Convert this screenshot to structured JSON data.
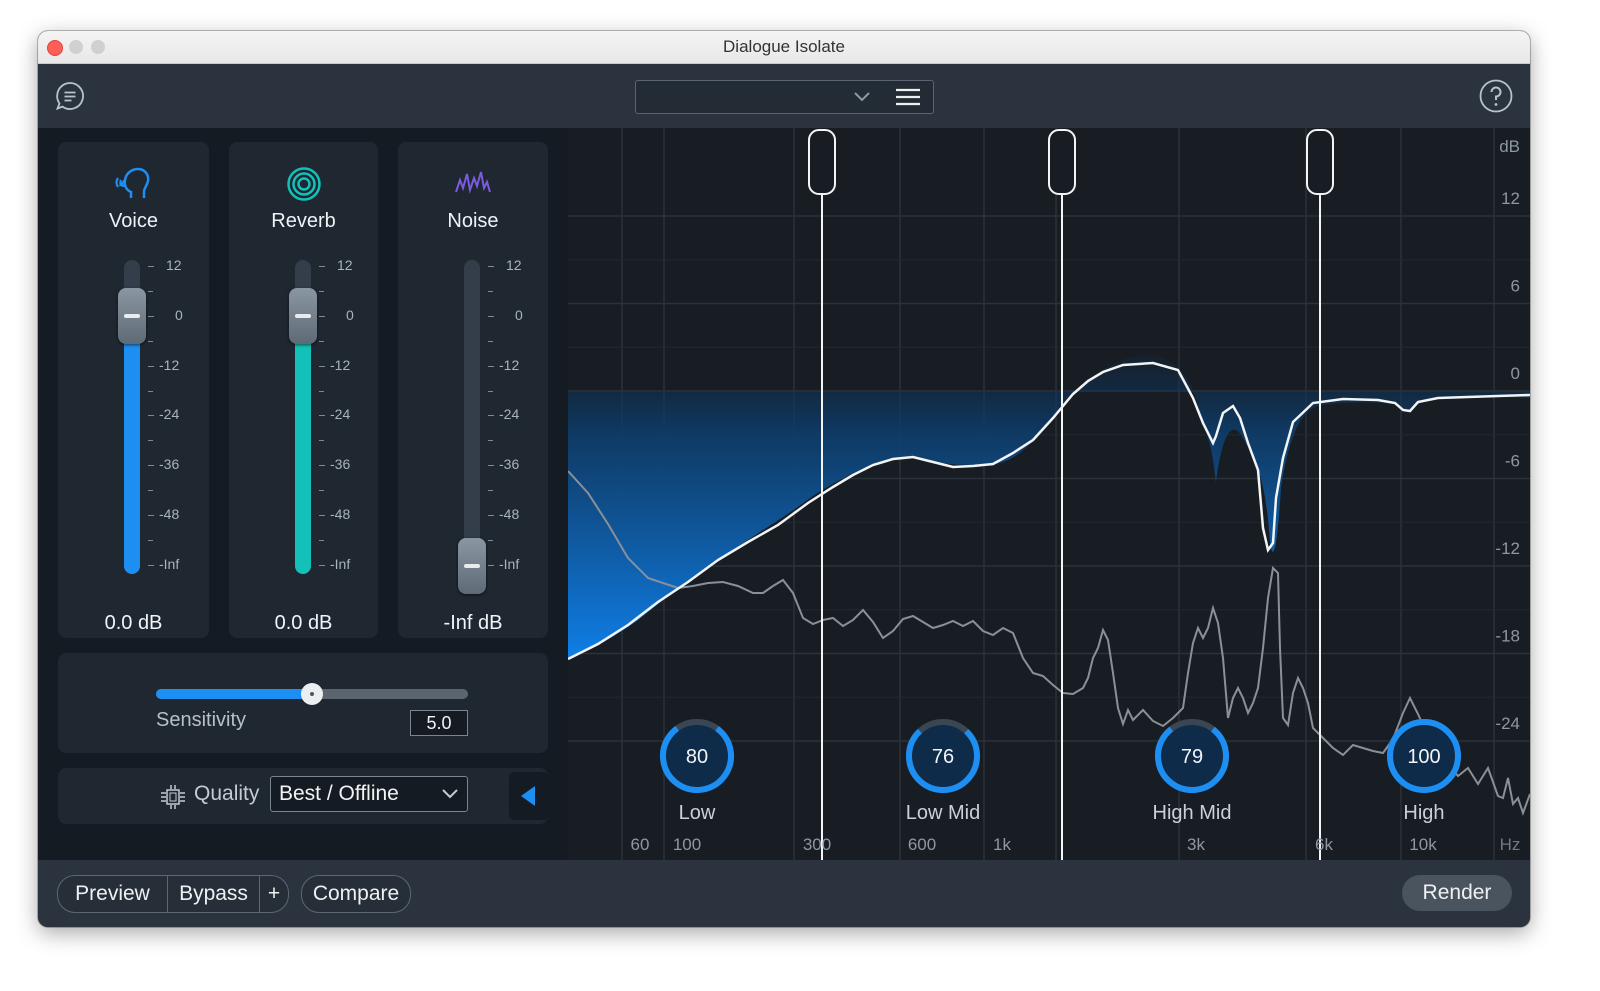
{
  "window": {
    "title": "Dialogue Isolate"
  },
  "toolbar": {
    "preset_value": "",
    "icons": [
      "feedback-icon",
      "chevron-down-icon",
      "hamburger-menu-icon",
      "help-icon"
    ]
  },
  "faders": [
    {
      "label": "Voice",
      "value": "0.0 dB",
      "icon": "voice-head-icon",
      "color": "#1d8ff3",
      "level_db": 0
    },
    {
      "label": "Reverb",
      "value": "0.0 dB",
      "icon": "reverb-rings-icon",
      "color": "#13c1b8",
      "level_db": 0
    },
    {
      "label": "Noise",
      "value": "-Inf dB",
      "icon": "noise-waves-icon",
      "color": "#6f4fd6",
      "level_db": "-Inf"
    }
  ],
  "fader_scale": [
    "12",
    "0",
    "-12",
    "-24",
    "-36",
    "-48",
    "-Inf"
  ],
  "sensitivity": {
    "label": "Sensitivity",
    "value": "5.0",
    "fraction": 0.5
  },
  "quality": {
    "label": "Quality",
    "selected": "Best / Offline"
  },
  "graph": {
    "db_unit": "dB",
    "db_labels": [
      "12",
      "6",
      "0",
      "-6",
      "-12",
      "-18",
      "-24"
    ],
    "freq_unit": "Hz",
    "freq_labels": [
      "60",
      "100",
      "300",
      "600",
      "1k",
      "3k",
      "6k",
      "10k"
    ],
    "crossovers_hz": [
      300,
      1000,
      6000
    ],
    "bands": [
      {
        "name": "Low",
        "value": "80"
      },
      {
        "name": "Low Mid",
        "value": "76"
      },
      {
        "name": "High Mid",
        "value": "79"
      },
      {
        "name": "High",
        "value": "100"
      }
    ]
  },
  "bottom": {
    "preview": "Preview",
    "bypass": "Bypass",
    "plus": "+",
    "compare": "Compare",
    "render": "Render"
  }
}
